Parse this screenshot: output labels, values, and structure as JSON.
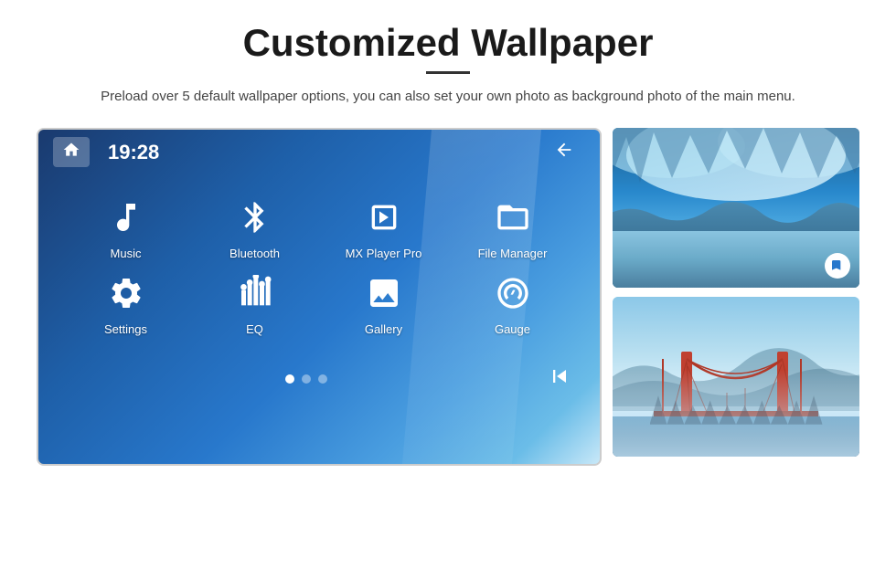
{
  "page": {
    "title": "Customized Wallpaper",
    "subtitle": "Preload over 5 default wallpaper options, you can also set your own photo as background photo of the main menu."
  },
  "screen": {
    "time": "19:28",
    "apps_row1": [
      {
        "id": "music",
        "label": "Music"
      },
      {
        "id": "bluetooth",
        "label": "Bluetooth"
      },
      {
        "id": "mxplayer",
        "label": "MX Player Pro"
      },
      {
        "id": "filemanager",
        "label": "File Manager"
      }
    ],
    "apps_row2": [
      {
        "id": "settings",
        "label": "Settings"
      },
      {
        "id": "eq",
        "label": "EQ"
      },
      {
        "id": "gallery",
        "label": "Gallery"
      },
      {
        "id": "gauge",
        "label": "Gauge"
      }
    ],
    "dots": [
      "active",
      "inactive",
      "inactive"
    ]
  },
  "icons": {
    "home": "⌂",
    "back": "↩",
    "skip": "⏮",
    "bookmark": "🔖",
    "music_note": "♪",
    "bluetooth": "bluetooth",
    "film": "film",
    "folder": "folder",
    "settings_gear": "gear",
    "eq_bars": "eq",
    "image": "image",
    "gauge_circle": "gauge"
  }
}
